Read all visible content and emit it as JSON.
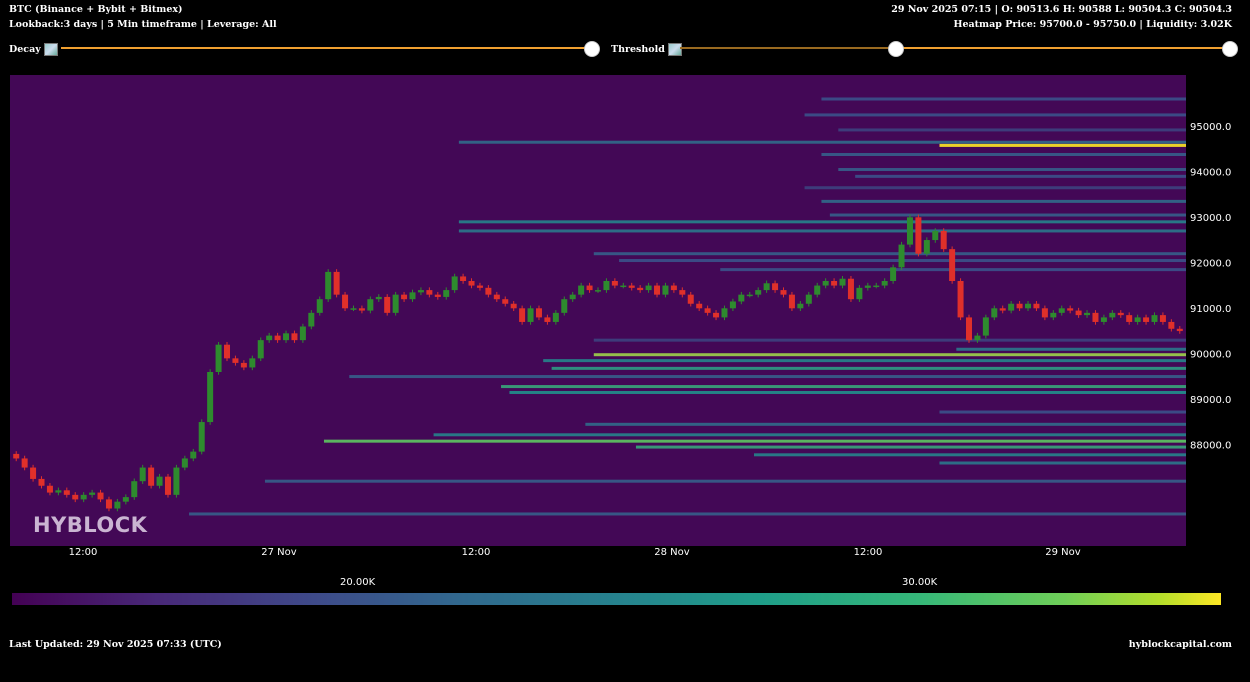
{
  "header": {
    "title": "BTC (Binance + Bybit + Bitmex)",
    "subtitle": "Lookback:3 days | 5 Min timeframe | Leverage: All",
    "ohlc": "29 Nov 2025 07:15 | O: 90513.6 H: 90588 L: 90504.3 C: 90504.3",
    "heatmap_info": "Heatmap Price: 95700.0 - 95750.0 | Liquidity: 3.02K"
  },
  "controls": {
    "decay_label": "Decay",
    "threshold_label": "Threshold",
    "decay_value": 1.0,
    "threshold_value": 0.5
  },
  "colors": {
    "background": "#000000",
    "plot_bg": "#430856",
    "slider": "#f0a030",
    "up_candle": "#2e8b2e",
    "down_candle": "#e0302a"
  },
  "watermark": "HYBLOCK",
  "colorbar": {
    "ticks": [
      {
        "label": "20.00K",
        "value": 20000
      },
      {
        "label": "30.00K",
        "value": 30000
      }
    ],
    "colormap": "viridis"
  },
  "footer": {
    "updated": "Last Updated: 29 Nov 2025 07:33 (UTC)",
    "site": "hyblockcapital.com"
  },
  "chart_data": {
    "type": "heatmap",
    "title": "",
    "x_range": [
      "26 Nov 2025 04:00",
      "29 Nov 2025 07:15"
    ],
    "y_range": [
      87200,
      96000
    ],
    "x_ticks": [
      "12:00",
      "27 Nov",
      "12:00",
      "28 Nov",
      "12:00",
      "29 Nov"
    ],
    "y_ticks": [
      "88000.0",
      "89000.0",
      "90000.0",
      "91000.0",
      "92000.0",
      "93000.0",
      "94000.0",
      "95000.0"
    ],
    "price_series": {
      "name": "BTC price",
      "points": [
        [
          0,
          87800
        ],
        [
          1,
          87700
        ],
        [
          2,
          87500
        ],
        [
          3,
          87250
        ],
        [
          4,
          87100
        ],
        [
          5,
          86950
        ],
        [
          6,
          87000
        ],
        [
          7,
          86900
        ],
        [
          8,
          86800
        ],
        [
          9,
          86900
        ],
        [
          10,
          86950
        ],
        [
          11,
          86800
        ],
        [
          12,
          86600
        ],
        [
          13,
          86750
        ],
        [
          14,
          86850
        ],
        [
          15,
          87200
        ],
        [
          16,
          87500
        ],
        [
          17,
          87100
        ],
        [
          18,
          87300
        ],
        [
          19,
          86900
        ],
        [
          20,
          87500
        ],
        [
          21,
          87700
        ],
        [
          22,
          87850
        ],
        [
          23,
          88500
        ],
        [
          24,
          89600
        ],
        [
          25,
          90200
        ],
        [
          26,
          89900
        ],
        [
          27,
          89800
        ],
        [
          28,
          89700
        ],
        [
          29,
          89900
        ],
        [
          30,
          90300
        ],
        [
          31,
          90400
        ],
        [
          32,
          90300
        ],
        [
          33,
          90450
        ],
        [
          34,
          90300
        ],
        [
          35,
          90600
        ],
        [
          36,
          90900
        ],
        [
          37,
          91200
        ],
        [
          38,
          91800
        ],
        [
          39,
          91300
        ],
        [
          40,
          91000
        ],
        [
          41,
          91000
        ],
        [
          42,
          90950
        ],
        [
          43,
          91200
        ],
        [
          44,
          91250
        ],
        [
          45,
          90900
        ],
        [
          46,
          91300
        ],
        [
          47,
          91200
        ],
        [
          48,
          91350
        ],
        [
          49,
          91400
        ],
        [
          50,
          91300
        ],
        [
          51,
          91250
        ],
        [
          52,
          91400
        ],
        [
          53,
          91700
        ],
        [
          54,
          91600
        ],
        [
          55,
          91500
        ],
        [
          56,
          91450
        ],
        [
          57,
          91300
        ],
        [
          58,
          91200
        ],
        [
          59,
          91100
        ],
        [
          60,
          91000
        ],
        [
          61,
          90700
        ],
        [
          62,
          91000
        ],
        [
          63,
          90800
        ],
        [
          64,
          90700
        ],
        [
          65,
          90900
        ],
        [
          66,
          91200
        ],
        [
          67,
          91300
        ],
        [
          68,
          91500
        ],
        [
          69,
          91400
        ],
        [
          70,
          91400
        ],
        [
          71,
          91600
        ],
        [
          72,
          91500
        ],
        [
          73,
          91500
        ],
        [
          74,
          91450
        ],
        [
          75,
          91400
        ],
        [
          76,
          91500
        ],
        [
          77,
          91300
        ],
        [
          78,
          91500
        ],
        [
          79,
          91400
        ],
        [
          80,
          91300
        ],
        [
          81,
          91100
        ],
        [
          82,
          91000
        ],
        [
          83,
          90900
        ],
        [
          84,
          90800
        ],
        [
          85,
          91000
        ],
        [
          86,
          91150
        ],
        [
          87,
          91300
        ],
        [
          88,
          91300
        ],
        [
          89,
          91400
        ],
        [
          90,
          91550
        ],
        [
          91,
          91400
        ],
        [
          92,
          91300
        ],
        [
          93,
          91000
        ],
        [
          94,
          91100
        ],
        [
          95,
          91300
        ],
        [
          96,
          91500
        ],
        [
          97,
          91600
        ],
        [
          98,
          91500
        ],
        [
          99,
          91650
        ],
        [
          100,
          91200
        ],
        [
          101,
          91450
        ],
        [
          102,
          91500
        ],
        [
          103,
          91500
        ],
        [
          104,
          91600
        ],
        [
          105,
          91900
        ],
        [
          106,
          92400
        ],
        [
          107,
          93000
        ],
        [
          108,
          92200
        ],
        [
          109,
          92500
        ],
        [
          110,
          92700
        ],
        [
          111,
          92300
        ],
        [
          112,
          91600
        ],
        [
          113,
          90800
        ],
        [
          114,
          90300
        ],
        [
          115,
          90400
        ],
        [
          116,
          90800
        ],
        [
          117,
          91000
        ],
        [
          118,
          90950
        ],
        [
          119,
          91100
        ],
        [
          120,
          91000
        ],
        [
          121,
          91100
        ],
        [
          122,
          91000
        ],
        [
          123,
          90800
        ],
        [
          124,
          90900
        ],
        [
          125,
          91000
        ],
        [
          126,
          90950
        ],
        [
          127,
          90850
        ],
        [
          128,
          90900
        ],
        [
          129,
          90700
        ],
        [
          130,
          90800
        ],
        [
          131,
          90900
        ],
        [
          132,
          90850
        ],
        [
          133,
          90700
        ],
        [
          134,
          90800
        ],
        [
          135,
          90700
        ],
        [
          136,
          90850
        ],
        [
          137,
          90700
        ],
        [
          138,
          90550
        ],
        [
          139,
          90500
        ]
      ]
    },
    "liquidity_bands": [
      {
        "price": 95600,
        "start": 96,
        "intensity": 0.25
      },
      {
        "price": 95250,
        "start": 94,
        "intensity": 0.25
      },
      {
        "price": 94920,
        "start": 98,
        "intensity": 0.2
      },
      {
        "price": 94650,
        "start": 53,
        "intensity": 0.35
      },
      {
        "price": 94580,
        "start": 110,
        "intensity": 1.0
      },
      {
        "price": 94380,
        "start": 96,
        "intensity": 0.3
      },
      {
        "price": 94050,
        "start": 98,
        "intensity": 0.3
      },
      {
        "price": 93900,
        "start": 100,
        "intensity": 0.25
      },
      {
        "price": 93650,
        "start": 94,
        "intensity": 0.2
      },
      {
        "price": 93350,
        "start": 96,
        "intensity": 0.35
      },
      {
        "price": 93050,
        "start": 97,
        "intensity": 0.3
      },
      {
        "price": 92900,
        "start": 53,
        "intensity": 0.45
      },
      {
        "price": 92700,
        "start": 53,
        "intensity": 0.4
      },
      {
        "price": 92200,
        "start": 69,
        "intensity": 0.3
      },
      {
        "price": 92050,
        "start": 72,
        "intensity": 0.25
      },
      {
        "price": 91850,
        "start": 84,
        "intensity": 0.25
      },
      {
        "price": 90300,
        "start": 69,
        "intensity": 0.2
      },
      {
        "price": 90100,
        "start": 112,
        "intensity": 0.4
      },
      {
        "price": 89980,
        "start": 69,
        "intensity": 0.85
      },
      {
        "price": 89850,
        "start": 63,
        "intensity": 0.45
      },
      {
        "price": 89680,
        "start": 64,
        "intensity": 0.55
      },
      {
        "price": 89500,
        "start": 40,
        "intensity": 0.3
      },
      {
        "price": 89280,
        "start": 58,
        "intensity": 0.6
      },
      {
        "price": 89150,
        "start": 59,
        "intensity": 0.5
      },
      {
        "price": 88720,
        "start": 110,
        "intensity": 0.25
      },
      {
        "price": 88450,
        "start": 68,
        "intensity": 0.35
      },
      {
        "price": 88220,
        "start": 50,
        "intensity": 0.45
      },
      {
        "price": 88080,
        "start": 37,
        "intensity": 0.75
      },
      {
        "price": 87950,
        "start": 74,
        "intensity": 0.6
      },
      {
        "price": 87780,
        "start": 88,
        "intensity": 0.45
      },
      {
        "price": 87600,
        "start": 110,
        "intensity": 0.4
      },
      {
        "price": 87200,
        "start": 30,
        "intensity": 0.3
      },
      {
        "price": 86480,
        "start": 21,
        "intensity": 0.3
      }
    ]
  }
}
